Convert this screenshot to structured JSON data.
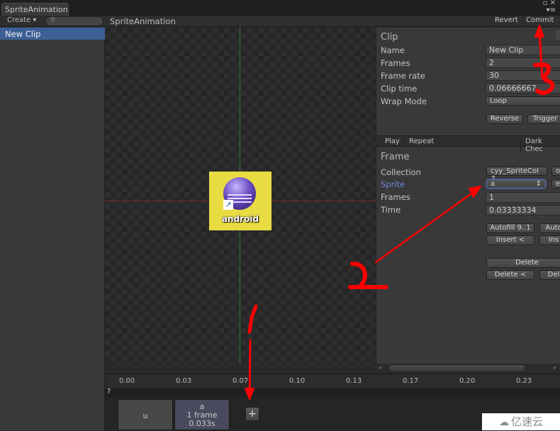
{
  "window": {
    "tab_title": "SpriteAnimation",
    "controls": {
      "maximize_glyph": "▫",
      "close_glyph": "✕",
      "menu_glyph": "▾≡"
    }
  },
  "left_panel": {
    "create_label": "Create ▾",
    "search": {
      "placeholder": "",
      "value": "",
      "icon": "search-icon"
    },
    "clips": [
      {
        "label": "New Clip",
        "selected": true
      }
    ]
  },
  "editor": {
    "title": "SpriteAnimation",
    "revert_label": "Revert",
    "commit_label": "Commit",
    "preview_sprite_label": "android"
  },
  "inspector": {
    "clip_section": {
      "title": "Clip",
      "fields": [
        {
          "label": "Name",
          "value": "New Clip"
        },
        {
          "label": "Frames",
          "value": "2"
        },
        {
          "label": "Frame rate",
          "value": "30"
        },
        {
          "label": "Clip time",
          "value": "0.06666667"
        }
      ],
      "wrap_mode_label": "Wrap Mode",
      "wrap_mode_value": "Loop",
      "reverse_label": "Reverse",
      "trigger_label": "Trigger"
    },
    "play_bar": {
      "play_label": "Play",
      "repeat_label": "Repeat",
      "background_label": "Dark Chec"
    },
    "frame_section": {
      "title": "Frame",
      "collection_label": "Collection",
      "collection_value": "cyy_SpriteCol",
      "collection_extra": "o",
      "sprite_label": "Sprite",
      "sprite_value": "a",
      "sprite_extra": "e",
      "frames_label": "Frames",
      "frames_value": "1",
      "time_label": "Time",
      "time_value": "0.03333334",
      "autofill_label": "Autofill 9..1",
      "autofill2_label": "Auto",
      "insert_before_label": "Insert <",
      "insert_after_label": "Ins",
      "delete_label": "Delete",
      "delete_before_label": "Delete <",
      "delete_after_label": "Del"
    }
  },
  "timeline": {
    "ticks": [
      "0.00",
      "0.03",
      "0.07",
      "0.10",
      "0.13",
      "0.17",
      "0.20",
      "0.23"
    ],
    "help_mark": "?"
  },
  "frame_strip": {
    "frames": [
      {
        "name": "u",
        "detail": "",
        "duration": "",
        "selected": false
      },
      {
        "name": "a",
        "detail": "1 frame",
        "duration": "0.033s",
        "selected": true
      }
    ],
    "add_label": "+"
  },
  "annotations": [
    {
      "label": "1",
      "color": "#ff0000"
    },
    {
      "label": "2",
      "color": "#ff0000"
    },
    {
      "label": "3",
      "color": "#ff0000"
    }
  ],
  "watermark": {
    "icon": "cloud-logo-icon",
    "text": "亿速云"
  }
}
